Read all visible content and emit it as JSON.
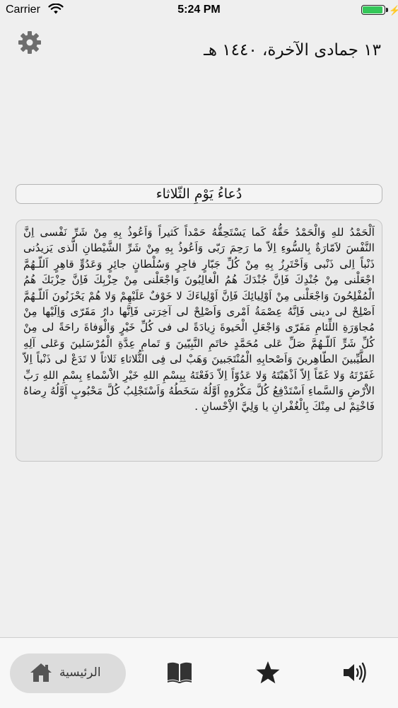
{
  "status_bar": {
    "carrier": "Carrier",
    "time": "5:24 PM",
    "battery_color": "#34c759"
  },
  "header": {
    "settings_icon": "gear-icon",
    "date": "١٣ جمادى الآخرة، ١٤٤٠ هـ"
  },
  "prayer": {
    "title": "دُعاءُ يَوْمِ الثّلاثاء",
    "text": "اَلْحَمْدُ للهِ وَالْحَمْدُ حَقُّهُ كَما يَسْتَحِقُّهُ حَمْداً كَثيراً وَاَعُوذُ بِهِ مِنْ شَرِّ نَفْسى اِنَّ النَّفْسَ لاََمّارَةٌ بِالسُّوءِ اِلاّ ما رَحِمَ رَبّى وَاَعُوذُ بِهِ مِنْ شَرِّ الشَّيْطانِ الَّذى يَزيدُنى ذَنْباً اِلى ذَنْبى وَاَحْتَرِزُ بِهِ مِنْ كُلِّ جَبّارٍ فاجِرٍ وَسُلْطانٍ جائِرٍ وَعَدُوٍّ قاهِرٍ اَللّـهُمَّ اجْعَلْنى مِنْ جُنْدِكَ فَاِنَّ جُنْدَكَ هُمُ الْغالِبُونَ وَاجْعَلْنى مِنْ حِزْبِكَ فَاِنَّ حِزْبَكَ هُمُ الْمُفْلِحُونَ وَاجْعَلْنى مِنْ اَوْلِيائِكَ فَاِنَّ اَوْلِياءَكَ لا خَوْفٌ عَلَيْهِمْ وَلا هُمْ يَحْزَنُونَ اَللّـهُمَّ اَصْلِحْ لى دينى فَاِنَّهُ عِصْمَةُ اَمْرى وَاَصْلِحْ لى آخِرَتى فَاِنَّها دارُ مَقَرّى وَاِلَيْها مِنْ مُجاوَرَةِ اللِّئامِ مَفَرّى وَاجْعَلِ الْحَيوةَ زِيادَةً لى فى كُلِّ خَيْرٍ وَالْوَفاةَ راحَةً لى مِنْ كُلِّ شَرٍّ اَللّـهُمَّ صَلِّ عَلى مُحَمَّدٍ خاتَمِ النَّبِيّينَ وَ تَمامِ عِدَّةِ الْمُرْسَلينَ وَعَلى آلِهِ الطَّيِّبينَ الطّاهِرينَ وَاَصْحابِهِ الْمُنْتَجَبينَ وَهَبْ لى فِى الثُّلاثاءِ ثَلاثاً لا تَدَعْ لى ذَنْباً اِلاّ غَفَرْتَهُ وَلا غَمّاً اِلاّ اَذْهَبْتَهُ وَلا عَدُوّاً اِلاّ دَفَعْتَهُ بِبِسْمِ اللهِ خَيْرِ الاَْسْماءِ بِسْمِ اللهِ رَبِّ الاَْرْضِ وَالسَّماءِ اَسْتَدْفِعُ كُلَّ مَكْرُوهٍ اَوَّلُهُ سَخَطُهُ وَاَسْتَجْلِبُ كُلَّ مَحْبُوبٍ اَوَّلُهُ رِضاهُ فَاخْتِمْ لى مِنْكَ بِالْغُفْرانِ يا وَلِيَّ الاِْحْسانِ ."
  },
  "tab_bar": {
    "home_label": "الرئيسية",
    "icons": [
      "home-icon",
      "book-icon",
      "star-icon",
      "speaker-icon"
    ]
  }
}
